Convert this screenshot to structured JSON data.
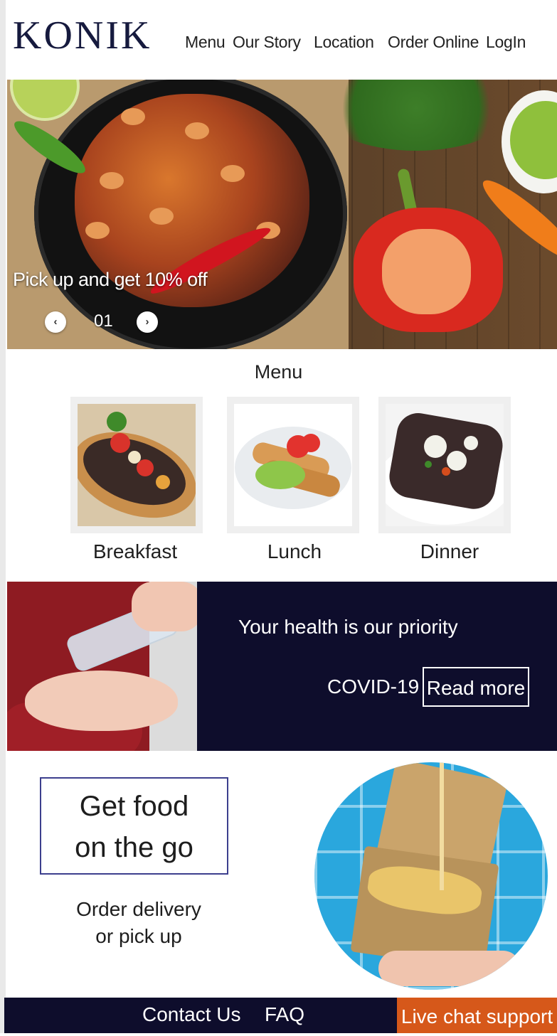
{
  "brand": {
    "logo_text": "KONIK"
  },
  "nav": {
    "items": [
      {
        "label": "Menu"
      },
      {
        "label": "Our Story"
      },
      {
        "label": "Location"
      },
      {
        "label": "Order Online"
      },
      {
        "label": "LogIn"
      }
    ]
  },
  "hero": {
    "caption": "Pick up and get 10% off",
    "slide_number": "01",
    "prev_icon": "chevron-left-icon",
    "next_icon": "chevron-right-icon"
  },
  "menu": {
    "title": "Menu",
    "categories": [
      {
        "label": "Breakfast"
      },
      {
        "label": "Lunch"
      },
      {
        "label": "Dinner"
      }
    ]
  },
  "health": {
    "title": "Your health is our priority",
    "topic": "COVID-19",
    "button_label": "Read more"
  },
  "promo": {
    "heading_line1": "Get food",
    "heading_line2": "on the go",
    "subtext_line1": "Order delivery",
    "subtext_line2": "or pick up"
  },
  "footer": {
    "contact_label": "Contact Us",
    "faq_label": "FAQ",
    "chat_label": "Live chat support"
  },
  "colors": {
    "navy": "#0e0d2c",
    "accent_orange": "#d6581a",
    "logo_navy": "#161a3e",
    "box_border": "#3c3f8e"
  }
}
